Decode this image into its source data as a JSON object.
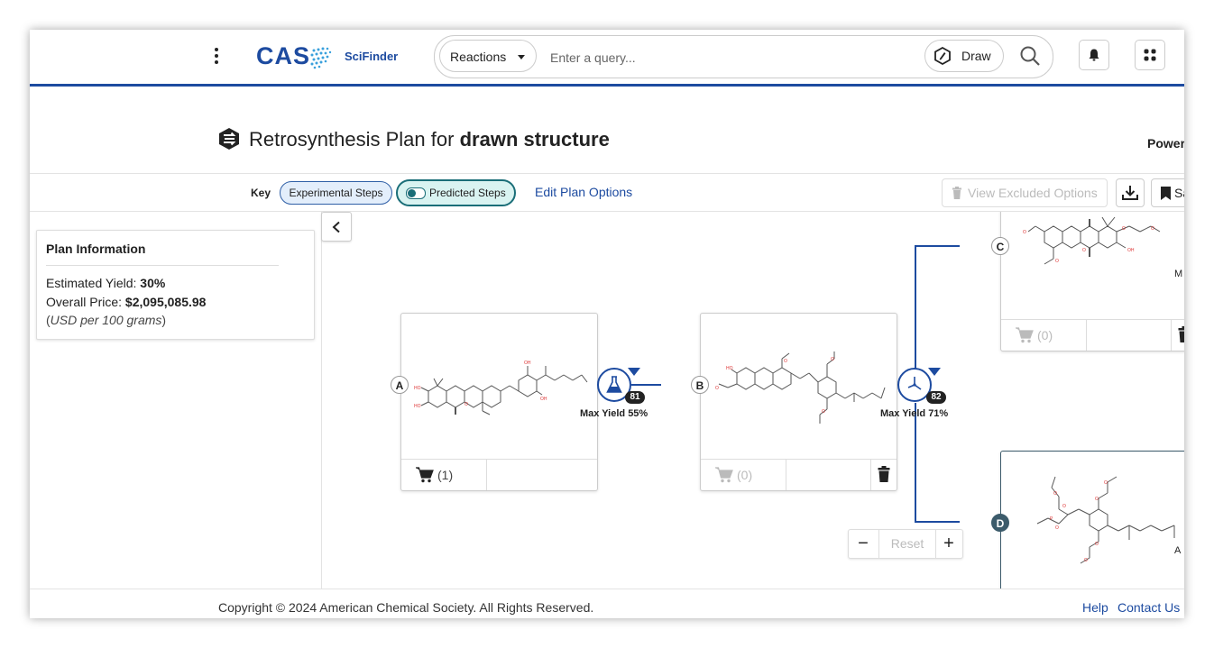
{
  "header": {
    "menu_icon": "kebab-vertical-icon",
    "logo_cas": "CAS",
    "logo_product": "SciFinder",
    "search_type": "Reactions",
    "search_placeholder": "Enter a query...",
    "draw_label": "Draw",
    "accent_color": "#1d4ba0"
  },
  "page": {
    "title_bold": "Retrosynthesis Plan",
    "title_mid": "for",
    "title_tail": "drawn structure",
    "powered_by": "Power"
  },
  "key_bar": {
    "key_label": "Key",
    "experimental": "Experimental Steps",
    "predicted": "Predicted Steps",
    "edit_options": "Edit Plan Options",
    "view_excluded": "View Excluded Options",
    "save_label": "Sa"
  },
  "plan_info": {
    "heading": "Plan Information",
    "yield_label": "Estimated Yield:",
    "yield_value": "30%",
    "price_label": "Overall Price:",
    "price_value": "$2,095,085.98",
    "price_note_open": "(",
    "price_note": "USD per 100 grams",
    "price_note_close": ")"
  },
  "tree": {
    "nodes": [
      {
        "label": "A",
        "cart_count": "(1)",
        "cart_enabled": true
      },
      {
        "label": "B",
        "cart_count": "(0)",
        "cart_enabled": false
      },
      {
        "label": "C",
        "cart_count": "(0)",
        "cart_enabled": false
      },
      {
        "label": "D",
        "cart_count": "",
        "cart_enabled": false
      }
    ],
    "reactions": [
      {
        "score": "81",
        "yield": "Max Yield 55%",
        "icon": "flask-icon"
      },
      {
        "score": "82",
        "yield": "Max Yield 71%",
        "icon": "predicted-reaction-icon"
      }
    ],
    "edge_hint_c": "M",
    "edge_hint_d": "A"
  },
  "zoom": {
    "minus": "−",
    "reset": "Reset",
    "plus": "+"
  },
  "footer": {
    "copyright": "Copyright © 2024 American Chemical Society. All Rights Reserved.",
    "help": "Help",
    "contact": "Contact Us"
  }
}
